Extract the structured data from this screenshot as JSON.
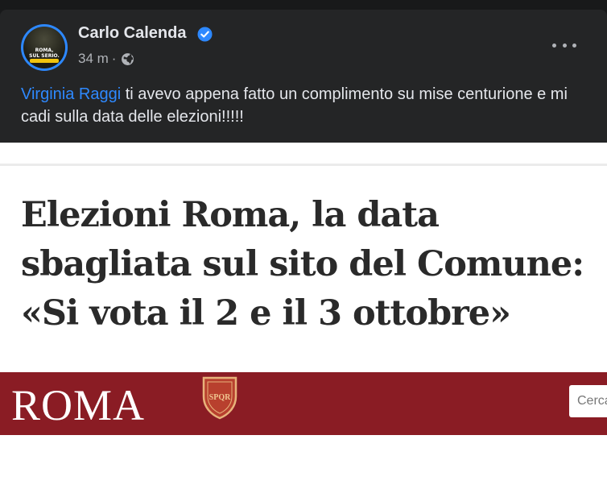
{
  "post": {
    "author": "Carlo Calenda",
    "time": "34 m",
    "separator": "·",
    "avatar_text": [
      "ROMA,",
      "SUL SERIO."
    ],
    "text_mention": "Virginia Raggi",
    "text_body": " ti avevo appena fatto un complimento su mise centurione e mi cadi sulla data delle elezioni!!!!!"
  },
  "image": {
    "headline_lines": [
      "Elezioni Roma, la data",
      "sbagliata sul sito del Comune:",
      "«Si vota il 2 e il 3 ottobre»"
    ],
    "banner_logo": "ROMA",
    "shield_text": "SPQR",
    "search_placeholder": "Cerca"
  },
  "colors": {
    "background": "#18191a",
    "card": "#242526",
    "mention": "#2e89ff",
    "verified": "#2d88ff",
    "banner": "#8a1c24"
  },
  "icons": {
    "verified": "verified-badge-icon",
    "privacy": "globe-icon",
    "menu": "more-options-icon",
    "shield": "roma-shield-icon"
  }
}
